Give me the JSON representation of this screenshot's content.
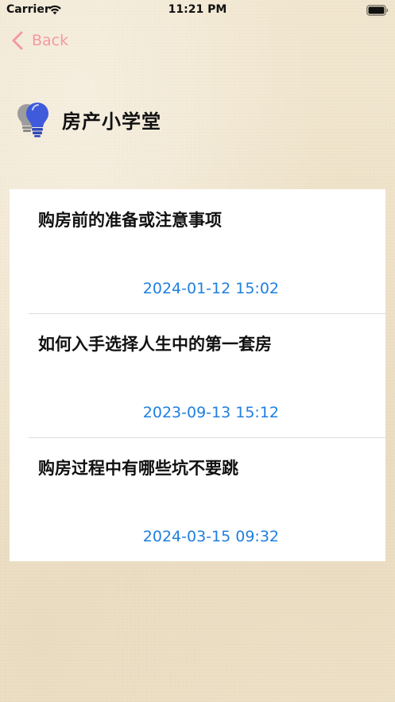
{
  "status_bar": {
    "carrier": "Carrier",
    "time": "11:21 PM",
    "wifi_icon": "wifi-icon",
    "battery_icon": "battery-icon"
  },
  "nav": {
    "back_label": "Back",
    "back_icon": "chevron-left-icon",
    "accent_color": "#f29aa3"
  },
  "header": {
    "icon": "lightbulb-icon",
    "title": "房产小学堂"
  },
  "articles": [
    {
      "title": "购房前的准备或注意事项",
      "date": "2024-01-12 15:02"
    },
    {
      "title": "如何入手选择人生中的第一套房",
      "date": "2023-09-13 15:12"
    },
    {
      "title": "购房过程中有哪些坑不要跳",
      "date": "2024-03-15 09:32"
    }
  ],
  "colors": {
    "date_text": "#1f7fe0",
    "card_background": "#ffffff",
    "page_background": "#f1e6cf"
  }
}
